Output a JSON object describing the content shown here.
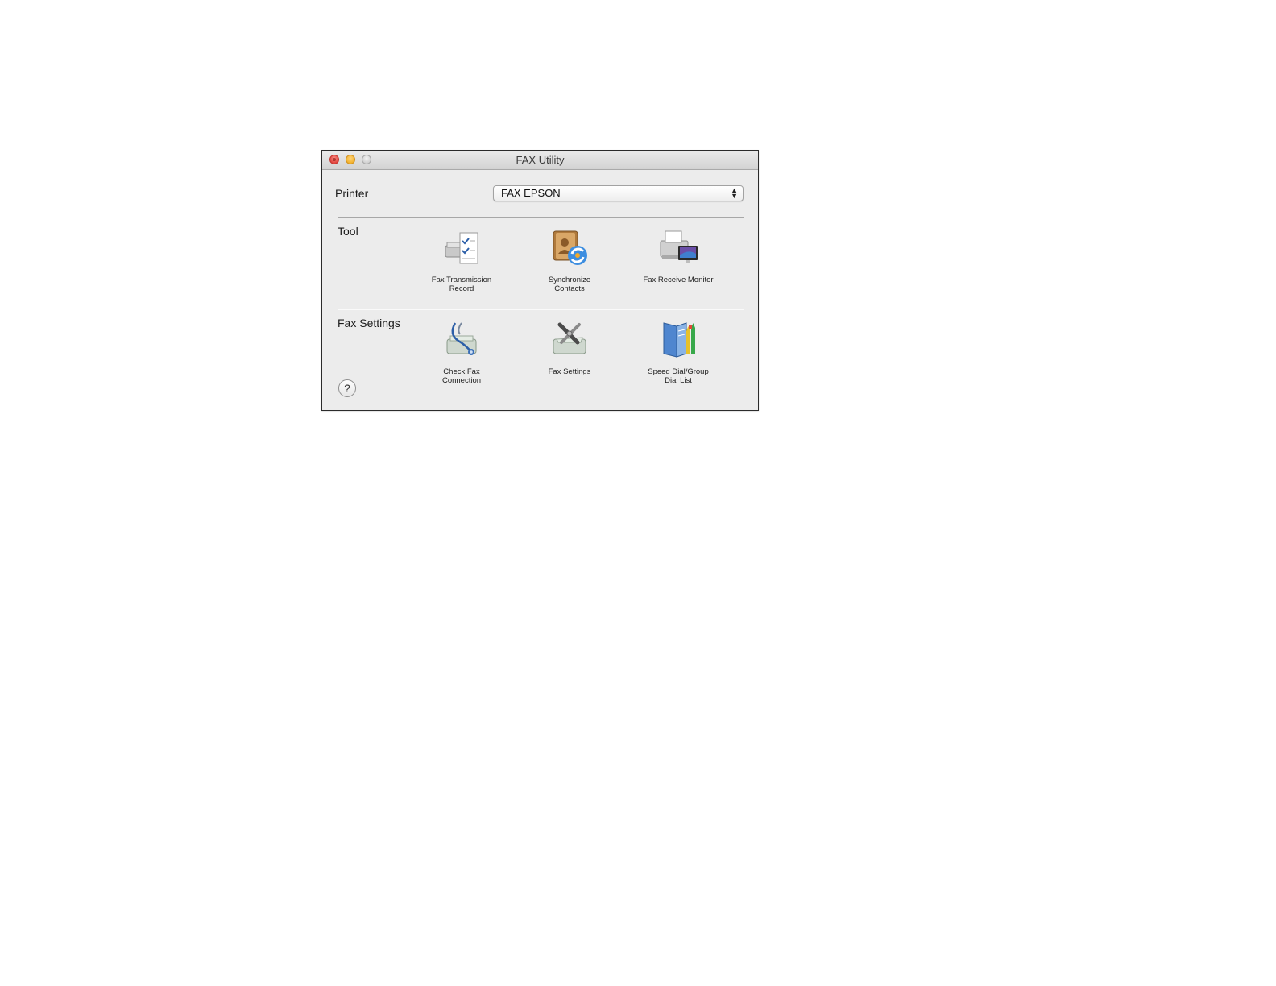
{
  "window": {
    "title": "FAX Utility",
    "controls": [
      "close",
      "minimize",
      "zoom"
    ]
  },
  "printer": {
    "label": "Printer",
    "selected": "FAX EPSON"
  },
  "tool_section": {
    "label": "Tool",
    "items": [
      {
        "label": "Fax Transmission\nRecord",
        "icon": "fax-transmission-record-icon"
      },
      {
        "label": "Synchronize\nContacts",
        "icon": "synchronize-contacts-icon"
      },
      {
        "label": "Fax Receive Monitor",
        "icon": "fax-receive-monitor-icon"
      }
    ]
  },
  "settings_section": {
    "label": "Fax Settings",
    "items": [
      {
        "label": "Check Fax\nConnection",
        "icon": "check-fax-connection-icon"
      },
      {
        "label": "Fax Settings",
        "icon": "fax-settings-icon"
      },
      {
        "label": "Speed Dial/Group\nDial List",
        "icon": "speed-dial-list-icon"
      }
    ]
  },
  "help": {
    "symbol": "?",
    "icon": "help-icon"
  }
}
